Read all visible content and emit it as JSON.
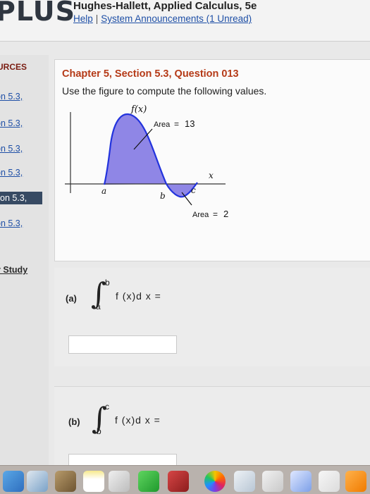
{
  "header": {
    "logo": "PLUS",
    "book_title": "Hughes-Hallett, Applied Calculus, 5e",
    "help_link": "Help",
    "separator": "|",
    "announcements_link": "System Announcements (1 Unread)"
  },
  "sidebar": {
    "heading": "URCES",
    "items": [
      {
        "label": "on 5.3,"
      },
      {
        "label": "on 5.3,"
      },
      {
        "label": "on 5.3,"
      },
      {
        "label": "on 5.3,"
      },
      {
        "label": "on 5.3,"
      },
      {
        "label": "on 5.3,"
      }
    ],
    "study_link": "y Study"
  },
  "question": {
    "title": "Chapter 5, Section 5.3, Question 013",
    "prompt": "Use the figure to compute the following values.",
    "figure": {
      "fx_label": "f(x)",
      "area1_label": "Area",
      "area1_eq": "=",
      "area1_value": "13",
      "area2_label": "Area",
      "area2_eq": "=",
      "area2_value": "2",
      "x_label": "x",
      "a_label": "a",
      "b_label": "b",
      "c_label": "c",
      "fill_color": "#8f86e6",
      "curve_color": "#2233dd"
    }
  },
  "part_a": {
    "label": "(a)",
    "upper": "b",
    "lower": "a",
    "expr": "f (x)d x =",
    "input_value": ""
  },
  "part_b": {
    "label": "(b)",
    "upper": "c",
    "lower": "b",
    "expr": "f (x)d x =",
    "input_value": ""
  },
  "dock": {
    "icons": [
      "finder-icon",
      "preview-icon",
      "notes-icon",
      "photos-icon",
      "facetime-icon",
      "photo-booth-icon",
      "photos-app-icon",
      "calendar-icon",
      "charts-icon",
      "keynote-icon",
      "music-icon",
      "misc-icon"
    ]
  }
}
